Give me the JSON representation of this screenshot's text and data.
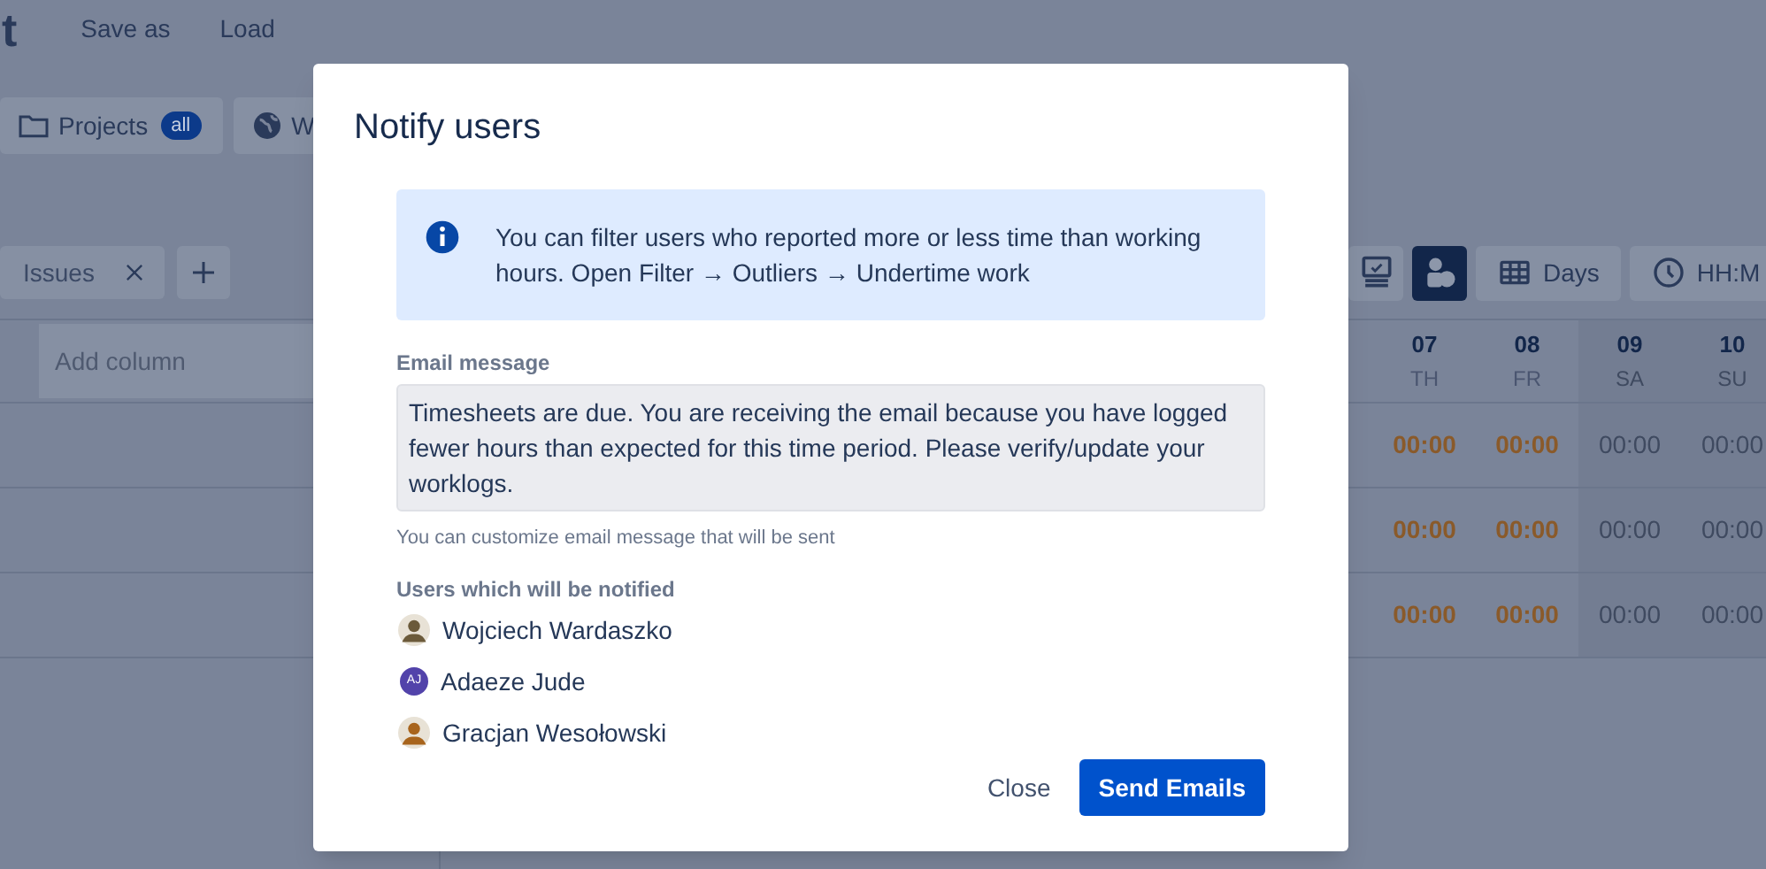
{
  "app": {
    "title": "t",
    "menu": [
      "Save as",
      "Load"
    ],
    "filters": [
      {
        "kind": "folder",
        "label": "Projects",
        "badge": "all"
      },
      {
        "kind": "globe",
        "label": "W"
      }
    ],
    "grouping": {
      "label": "Issues"
    },
    "view_buttons": [
      {
        "kind": "monitor",
        "selected": false
      },
      {
        "kind": "users",
        "selected": true
      }
    ],
    "period": {
      "kind": "grid",
      "label": "Days"
    },
    "format": {
      "kind": "clock",
      "label": "HH:M"
    },
    "table": {
      "add_column": {
        "placeholder": "Add column"
      },
      "days": [
        {
          "date": "07",
          "weekday": "TH",
          "weekend": false
        },
        {
          "date": "08",
          "weekday": "FR",
          "weekend": false
        },
        {
          "date": "09",
          "weekday": "SA",
          "weekend": true
        },
        {
          "date": "10",
          "weekday": "SU",
          "weekend": true
        }
      ],
      "rows": [
        {
          "cells": [
            "00:00",
            "00:00",
            "00:00",
            "00:00"
          ]
        },
        {
          "cells": [
            "00:00",
            "00:00",
            "00:00",
            "00:00"
          ]
        },
        {
          "cells": [
            "00:00",
            "00:00",
            "00:00",
            "00:00"
          ]
        }
      ]
    }
  },
  "dialog": {
    "title": "Notify users",
    "info": "You can filter users who reported more or less time than working hours. Open Filter → Outliers → Undertime work",
    "message_label": "Email message",
    "message": "Timesheets are due. You are receiving the email because you have logged fewer hours than expected for this time period. Please verify/update your worklogs.",
    "message_hint": "You can customize email message that will be sent",
    "users_label": "Users which will be notified",
    "users": [
      {
        "kind": "photo",
        "color": "#6b5a3a",
        "name": "Wojciech Wardaszko"
      },
      {
        "kind": "initials",
        "initials": "AJ",
        "color": "#5243aa",
        "name": "Adaeze Jude"
      },
      {
        "kind": "photo",
        "color": "#a8641c",
        "name": "Gracjan Wesołowski"
      }
    ],
    "buttons": {
      "close": "Close",
      "send": "Send Emails"
    }
  }
}
